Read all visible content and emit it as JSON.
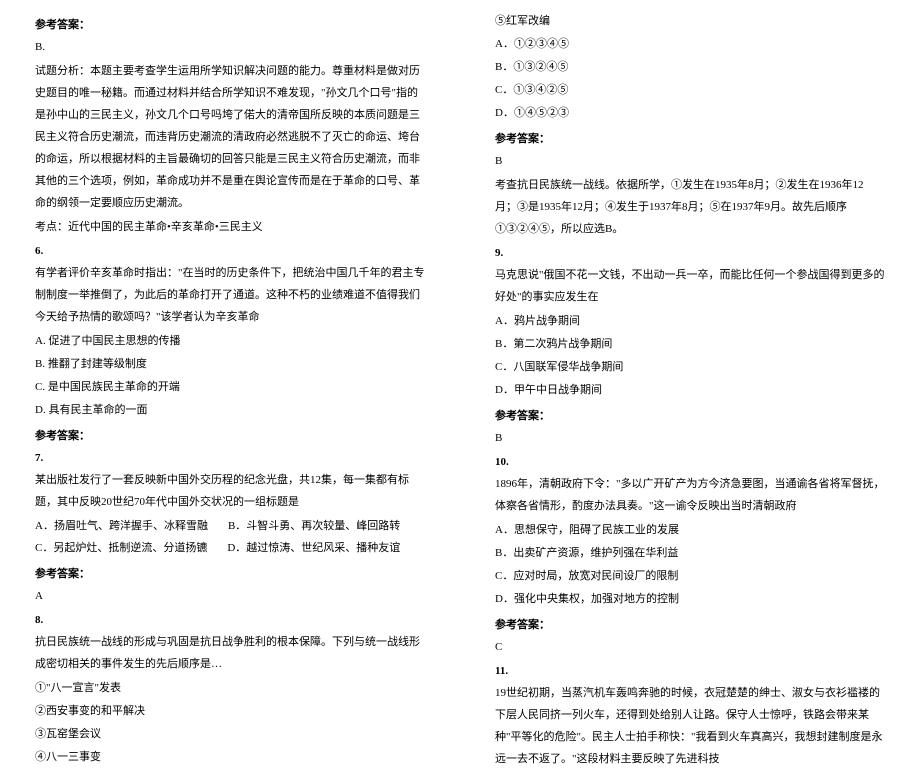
{
  "left": {
    "ans5_label": "参考答案：",
    "ans5_letter": "B.",
    "ans5_p1": "试题分析：本题主要考查学生运用所学知识解决问题的能力。尊重材料是做对历史题目的唯一秘籍。而通过材料并结合所学知识不难发现，\"孙文几个口号\"指的是孙中山的三民主义，孙文几个口号吗垮了偌大的清帝国所反映的本质问题是三民主义符合历史潮流，而违背历史潮流的清政府必然逃脱不了灭亡的命运、垮台的命运，所以根据材料的主旨最确切的回答只能是三民主义符合历史潮流，而非其他的三个选项，例如，革命成功并不是重在舆论宣传而是在于革命的口号、革命的纲领一定要顺应历史潮流。",
    "ans5_p2": "考点：近代中国的民主革命•辛亥革命•三民主义",
    "q6_num": "6.",
    "q6_stem": "有学者评价辛亥革命时指出：\"在当时的历史条件下，把统治中国几千年的君主专制制度一举推倒了，为此后的革命打开了通道。这种不朽的业绩难道不值得我们今天给予热情的歌颂吗？\"该学者认为辛亥革命",
    "q6_a": "A. 促进了中国民主思想的传播",
    "q6_b": "B. 推翻了封建等级制度",
    "q6_c": "C. 是中国民族民主革命的开端",
    "q6_d": "D. 具有民主革命的一面",
    "ans6_label": "参考答案：",
    "q7_num": "7.",
    "q7_stem": "某出版社发行了一套反映新中国外交历程的纪念光盘，共12集，每一集都有标题，其中反映20世纪70年代中国外交状况的一组标题是",
    "q7_a": "A．扬眉吐气、跨洋握手、冰释雪融",
    "q7_b": "B．斗智斗勇、再次较量、峰回路转",
    "q7_c": "C．另起炉灶、抵制逆流、分道扬镳",
    "q7_d": "D．越过惊涛、世纪风采、播种友谊",
    "ans7_label": "参考答案：",
    "ans7_letter": "A",
    "q8_num": "8.",
    "q8_stem": "抗日民族统一战线的形成与巩固是抗日战争胜利的根本保障。下列与统一战线形成密切相关的事件发生的先后顺序是…",
    "q8_opt1": "①\"八一宣言\"发表",
    "q8_opt2": "②西安事变的和平解决",
    "q8_opt3": "③瓦窑堡会议",
    "q8_opt4": "④八一三事变"
  },
  "right": {
    "q8_opt5": "⑤红军改编",
    "q8_a": "A．①②③④⑤",
    "q8_b": "B．①③②④⑤",
    "q8_c": "C．①③④②⑤",
    "q8_d": "D．①④⑤②③",
    "ans8_label": "参考答案：",
    "ans8_letter": "B",
    "ans8_p": "考查抗日民族统一战线。依据所学，①发生在1935年8月；②发生在1936年12月；③是1935年12月；④发生于1937年8月；⑤在1937年9月。故先后顺序①③②④⑤，所以应选B。",
    "q9_num": "9.",
    "q9_stem": "马克思说\"俄国不花一文钱，不出动一兵一卒，而能比任何一个参战国得到更多的好处\"的事实应发生在",
    "q9_a": "A．鸦片战争期间",
    "q9_b": "B．第二次鸦片战争期间",
    "q9_c": "C．八国联军侵华战争期间",
    "q9_d": "D．甲午中日战争期间",
    "ans9_label": "参考答案：",
    "ans9_letter": "B",
    "q10_num": "10.",
    "q10_stem": "1896年，清朝政府下令：\"多以广开矿产为方今济急要图，当通谕各省将军督抚，体察各省情形，酌度办法具奏。\"这一谕令反映出当时清朝政府",
    "q10_a": "A．思想保守，阻碍了民族工业的发展",
    "q10_b": "B．出卖矿产资源，维护列强在华利益",
    "q10_c": "C．应对时局，放宽对民间设厂的限制",
    "q10_d": "D．强化中央集权，加强对地方的控制",
    "ans10_label": "参考答案：",
    "ans10_letter": "C",
    "q11_num": "11.",
    "q11_stem": "19世纪初期，当蒸汽机车轰鸣奔驰的时候，衣冠楚楚的绅士、淑女与衣衫褴褛的下层人民同挤一列火车，还得到处给别人让路。保守人士惊呼，铁路会带来某种\"平等化的危险\"。民主人士拍手称快：\"我看到火车真高兴，我想封建制度是永远一去不返了。\"这段材料主要反映了先进科技"
  }
}
